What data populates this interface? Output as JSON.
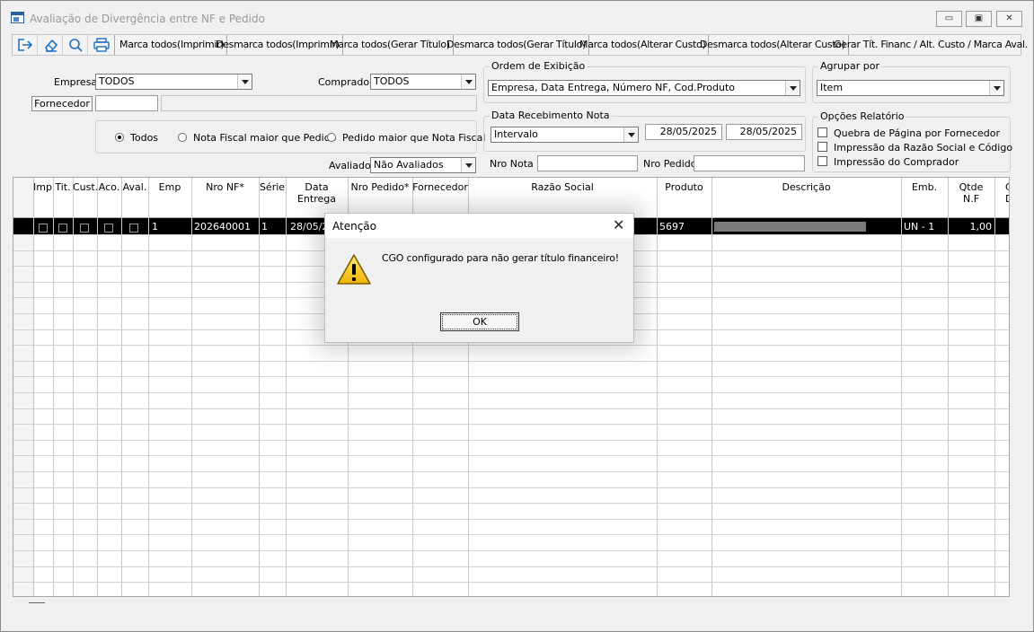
{
  "window": {
    "title": "Avaliação de Divergência entre NF e Pedido",
    "controls": {
      "minimize": "▭",
      "maximize": "▣",
      "close": "✕"
    }
  },
  "toolbar": {
    "icons": [
      "exit-icon",
      "eraser-icon",
      "search-icon",
      "printer-icon"
    ],
    "buttons": [
      "Marca todos(Imprimir)",
      "Desmarca todos(Imprimir)",
      "Marca todos(Gerar Título)",
      "Desmarca todos(Gerar Título)",
      "Marca todos(Alterar Custo)",
      "Desmarca todos(Alterar Custo)",
      "Gerar Tít. Financ / Alt. Custo / Marca Aval."
    ]
  },
  "filters": {
    "empresa_label": "Empresa",
    "empresa_value": "TODOS",
    "comprador_label": "Comprador",
    "comprador_value": "TODOS",
    "fornecedor_button": "Fornecedor",
    "fornecedor_code": "",
    "fornecedor_name": "",
    "radios": [
      {
        "label": "Todos",
        "selected": true
      },
      {
        "label": "Nota Fiscal maior que Pedido",
        "selected": false
      },
      {
        "label": "Pedido maior que Nota Fiscal",
        "selected": false
      }
    ],
    "avaliado_label": "Avaliado",
    "avaliado_value": "Não Avaliados"
  },
  "ordem": {
    "title": "Ordem de Exibição",
    "value": "Empresa, Data Entrega, Número NF, Cod.Produto"
  },
  "agrupar": {
    "title": "Agrupar por",
    "value": "Item"
  },
  "recebimento": {
    "title": "Data Recebimento Nota",
    "tipo": "Intervalo",
    "data_inicio": "28/05/2025",
    "data_fim": "28/05/2025",
    "nro_nota_label": "Nro Nota",
    "nro_nota_value": "",
    "nro_pedido_label": "Nro Pedido",
    "nro_pedido_value": ""
  },
  "opcoes": {
    "title": "Opções Relatório",
    "items": [
      {
        "label": "Quebra de Página por Fornecedor",
        "checked": false
      },
      {
        "label": "Impressão da Razão Social e Código",
        "checked": false
      },
      {
        "label": "Impressão do Comprador",
        "checked": false
      }
    ]
  },
  "grid": {
    "columns": [
      {
        "l1": "Imp.",
        "l2": ""
      },
      {
        "l1": "Tit.",
        "l2": ""
      },
      {
        "l1": "Cust.",
        "l2": ""
      },
      {
        "l1": "Aco.",
        "l2": ""
      },
      {
        "l1": "Aval.",
        "l2": ""
      },
      {
        "l1": "Emp",
        "l2": ""
      },
      {
        "l1": "Nro NF*",
        "l2": ""
      },
      {
        "l1": "Série",
        "l2": ""
      },
      {
        "l1": "Data",
        "l2": "Entrega"
      },
      {
        "l1": "Nro Pedido*",
        "l2": ""
      },
      {
        "l1": "Fornecedor",
        "l2": ""
      },
      {
        "l1": "Razão Social",
        "l2": ""
      },
      {
        "l1": "Produto",
        "l2": ""
      },
      {
        "l1": "Descrição",
        "l2": ""
      },
      {
        "l1": "Emb.",
        "l2": ""
      },
      {
        "l1": "Qtde",
        "l2": "N.F"
      },
      {
        "l1": "C",
        "l2": "D"
      }
    ],
    "selected_row": {
      "emp": "1",
      "nro_nf": "202640001",
      "serie": "1",
      "data_entrega": "28/05/2",
      "produto": "5697",
      "emb": "UN - 1",
      "qtde": "1,00"
    },
    "colors": {
      "selected_bg": "#000000",
      "selected_text": "#ffffff",
      "redacted": "#7a7a7a"
    }
  },
  "dialog": {
    "title": "Atenção",
    "close": "✕",
    "message": "CGO configurado para não gerar título financeiro!",
    "ok": "OK",
    "icon": "warning-icon"
  }
}
